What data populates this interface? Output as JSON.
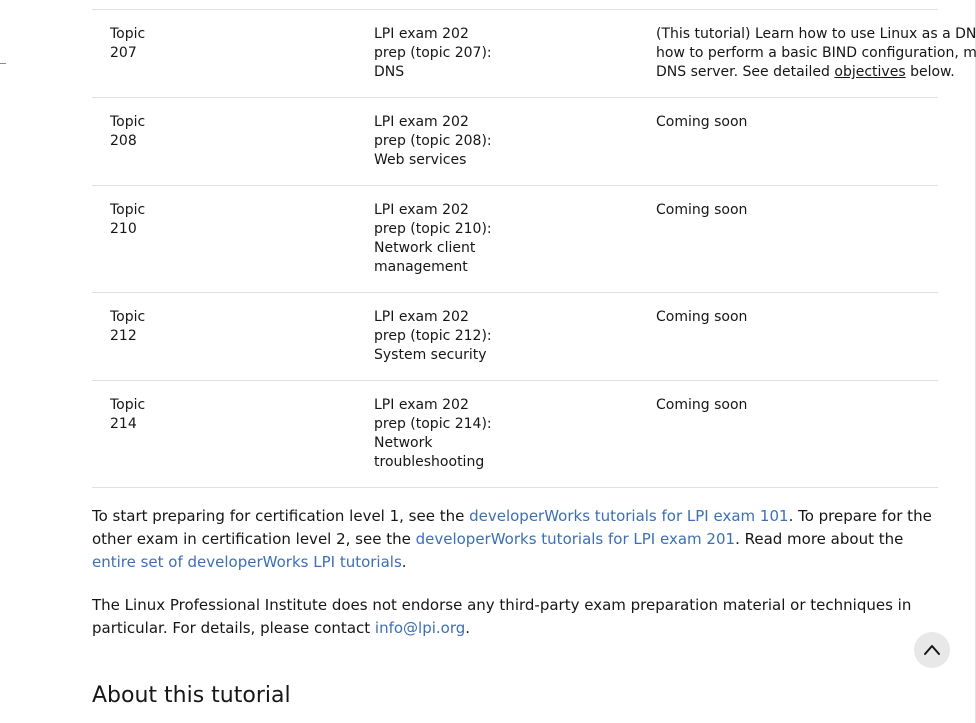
{
  "topics_table": {
    "rows": [
      {
        "topic": "Topic 207",
        "title": "LPI exam 202 prep (topic 207): DNS",
        "desc_before": "(This tutorial) Learn how to use Linux as a DNS server, chiefly using BIND. Learn how to perform a basic BIND configuration, manage DNS zones, and secure a DNS server. See detailed ",
        "desc_link": "objectives",
        "desc_after": " below."
      },
      {
        "topic": "Topic 208",
        "title": "LPI exam 202 prep (topic 208): Web services",
        "desc": "Coming soon"
      },
      {
        "topic": "Topic 210",
        "title": "LPI exam 202 prep (topic 210): Network client management",
        "desc": "Coming soon"
      },
      {
        "topic": "Topic 212",
        "title": "LPI exam 202 prep (topic 212): System security",
        "desc": "Coming soon"
      },
      {
        "topic": "Topic 214",
        "title": "LPI exam 202 prep (topic 214): Network troubleshooting",
        "desc": "Coming soon"
      }
    ]
  },
  "para1": {
    "t1": "To start preparing for certification level 1, see the ",
    "l1": "developerWorks tutorials for LPI exam 101",
    "t2": ". To prepare for the other exam in certification level 2, see the ",
    "l2": "developerWorks tutorials for LPI exam 201",
    "t3": ". Read more about the ",
    "l3": "entire set of developerWorks LPI tutorials",
    "t4": "."
  },
  "para2": {
    "t1": "The Linux Professional Institute does not endorse any third-party exam preparation material or techniques in particular. For details, please contact ",
    "l1": "info@lpi.org",
    "t2": "."
  },
  "section_heading": "About this tutorial",
  "back_to_top_icon": "chevron-up-icon",
  "colors": {
    "link": "#3d6fb4",
    "text": "#161616",
    "rule": "#e0e0e0"
  }
}
